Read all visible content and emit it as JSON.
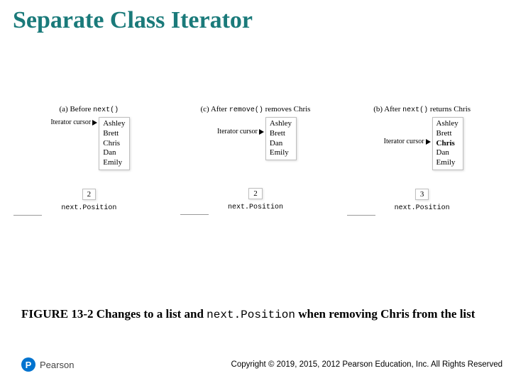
{
  "title": "Separate Class Iterator",
  "panels": [
    {
      "id": "a",
      "label_prefix": "(a) Before ",
      "label_code": "next()",
      "label_suffix": "",
      "cursor_text": "Iterator cursor",
      "cursor_row_index": 0,
      "items": [
        "Ashley",
        "Brett",
        "Chris",
        "Dan",
        "Emily"
      ],
      "bold_index": null,
      "position_value": "2",
      "position_label": "next.Position"
    },
    {
      "id": "c",
      "label_prefix": "(c) After ",
      "label_code": "remove()",
      "label_suffix": " removes Chris",
      "cursor_text": "Iterator cursor",
      "cursor_row_index": 1,
      "items": [
        "Ashley",
        "Brett",
        "Dan",
        "Emily"
      ],
      "bold_index": null,
      "position_value": "2",
      "position_label": "next.Position"
    },
    {
      "id": "b",
      "label_prefix": "(b) After ",
      "label_code": "next()",
      "label_suffix": " returns Chris",
      "cursor_text": "Iterator cursor",
      "cursor_row_index": 2,
      "items": [
        "Ashley",
        "Brett",
        "Chris",
        "Dan",
        "Emily"
      ],
      "bold_index": 2,
      "position_value": "3",
      "position_label": "next.Position"
    }
  ],
  "caption": {
    "figure_label": "FIGURE 13-2",
    "text_before_code": " Changes to a list and ",
    "code_text": "next.Position",
    "text_after_code": " when removing Chris from the list"
  },
  "brand": {
    "initial": "P",
    "name": "Pearson"
  },
  "copyright": "Copyright © 2019, 2015, 2012 Pearson Education, Inc. All Rights Reserved"
}
